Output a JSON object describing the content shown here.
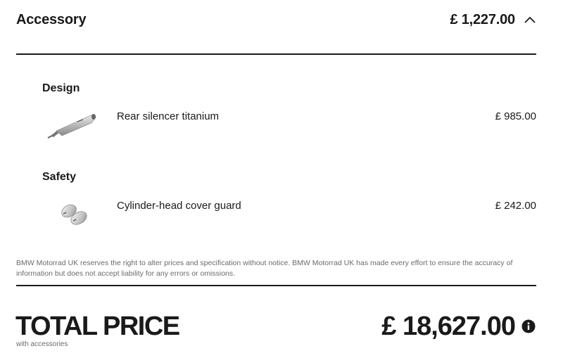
{
  "accessory": {
    "title": "Accessory",
    "total": "£ 1,227.00"
  },
  "categories": [
    {
      "name": "Design",
      "items": [
        {
          "name": "Rear silencer titanium",
          "price": "£ 985.00"
        }
      ]
    },
    {
      "name": "Safety",
      "items": [
        {
          "name": "Cylinder-head cover guard",
          "price": "£ 242.00"
        }
      ]
    }
  ],
  "disclaimer": "BMW Motorrad UK reserves the right to alter prices and specification without notice. BMW Motorrad UK has made every effort to ensure the accuracy of information but does not accept liability for any errors or omissions.",
  "total": {
    "label": "TOTAL PRICE",
    "sublabel": "with accessories",
    "price": "£ 18,627.00"
  },
  "icons": {
    "collapse": "chevron-up-icon",
    "info": "info-icon"
  }
}
